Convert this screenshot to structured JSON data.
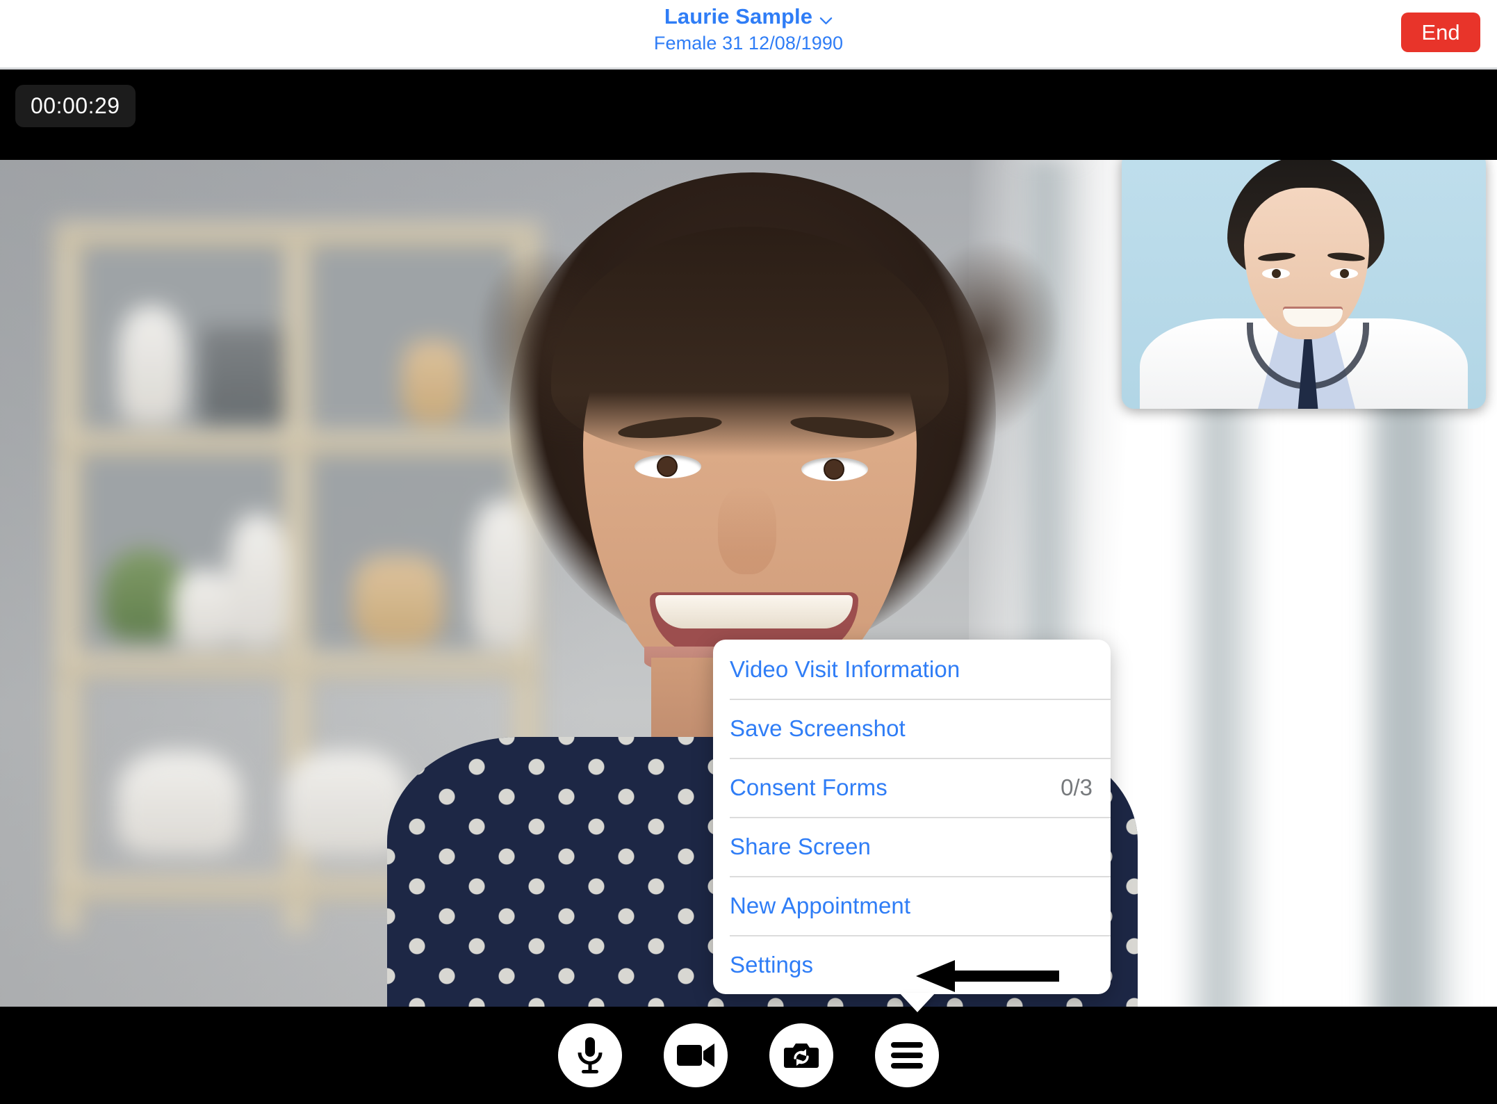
{
  "header": {
    "patient_name": "Laurie Sample",
    "patient_meta": "Female 31 12/08/1990",
    "chevron_icon": "chevron-down-icon",
    "end_button_label": "End",
    "accent_blue": "#2f7df6",
    "end_red": "#e8342a"
  },
  "video": {
    "timer": "00:00:29",
    "remote_participant": "Laurie Sample",
    "self_participant": "Provider"
  },
  "menu": {
    "items": [
      {
        "label": "Video Visit Information",
        "badge": ""
      },
      {
        "label": "Save Screenshot",
        "badge": ""
      },
      {
        "label": "Consent Forms",
        "badge": "0/3"
      },
      {
        "label": "Share Screen",
        "badge": ""
      },
      {
        "label": "New Appointment",
        "badge": ""
      },
      {
        "label": "Settings",
        "badge": ""
      }
    ],
    "highlighted_item": "New Appointment",
    "text_color": "#2f7df6",
    "badge_color": "#76797c"
  },
  "controls": [
    {
      "name": "microphone-button",
      "icon": "microphone-icon"
    },
    {
      "name": "camera-button",
      "icon": "video-camera-icon"
    },
    {
      "name": "flip-camera-button",
      "icon": "camera-flip-icon"
    },
    {
      "name": "menu-button",
      "icon": "hamburger-menu-icon"
    }
  ]
}
